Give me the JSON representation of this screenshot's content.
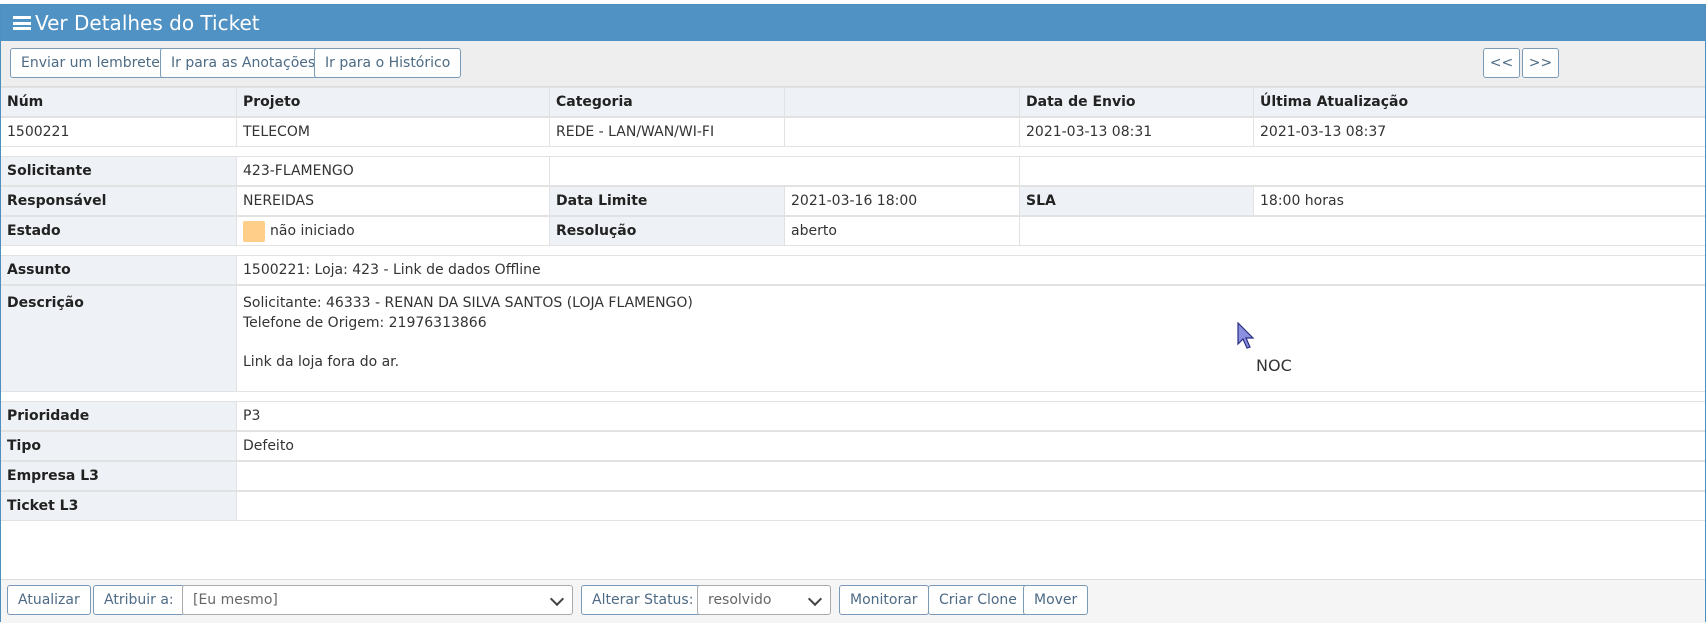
{
  "header": {
    "title": "Ver Detalhes do Ticket"
  },
  "toolbar": {
    "remind": "Enviar um lembrete",
    "notes": "Ir para as Anotações",
    "history": "Ir para o Histórico",
    "prev": "<<",
    "next": ">>"
  },
  "summary": {
    "headers": {
      "num": "Núm",
      "project": "Projeto",
      "category": "Categoria",
      "blank": "",
      "submitted": "Data de Envio",
      "updated": "Última Atualização"
    },
    "values": {
      "num": "1500221",
      "project": "TELECOM",
      "category": "REDE - LAN/WAN/WI-FI",
      "blank": "",
      "submitted": "2021-03-13 08:31",
      "updated": "2021-03-13 08:37"
    }
  },
  "details": {
    "requester_label": "Solicitante",
    "requester": "423-FLAMENGO",
    "assignee_label": "Responsável",
    "assignee": "NEREIDAS",
    "due_label": "Data Limite",
    "due": "2021-03-16 18:00",
    "sla_label": "SLA",
    "sla": "18:00 horas",
    "status_label": "Estado",
    "status": "não iniciado",
    "status_color": "#ffcf8a",
    "resolution_label": "Resolução",
    "resolution": "aberto"
  },
  "ticket": {
    "subject_label": "Assunto",
    "subject": "1500221: Loja: 423 - Link de dados Offline",
    "description_label": "Descrição",
    "description_line1": "Solicitante: 46333 - RENAN DA SILVA SANTOS (LOJA FLAMENGO)",
    "description_line2": "Telefone de Origem: 21976313866",
    "description_line3": "Link da loja fora do ar.",
    "overlay_text": "NOC"
  },
  "extra": {
    "priority_label": "Prioridade",
    "priority": "P3",
    "type_label": "Tipo",
    "type": "Defeito",
    "company_label": "Empresa L3",
    "company": "",
    "ticket_l3_label": "Ticket L3",
    "ticket_l3": ""
  },
  "actions": {
    "update": "Atualizar",
    "assign": "Atribuir a:",
    "assign_value": "[Eu mesmo]",
    "change_status": "Alterar Status:",
    "status_value": "resolvido",
    "monitor": "Monitorar",
    "clone": "Criar Clone",
    "move": "Mover"
  }
}
